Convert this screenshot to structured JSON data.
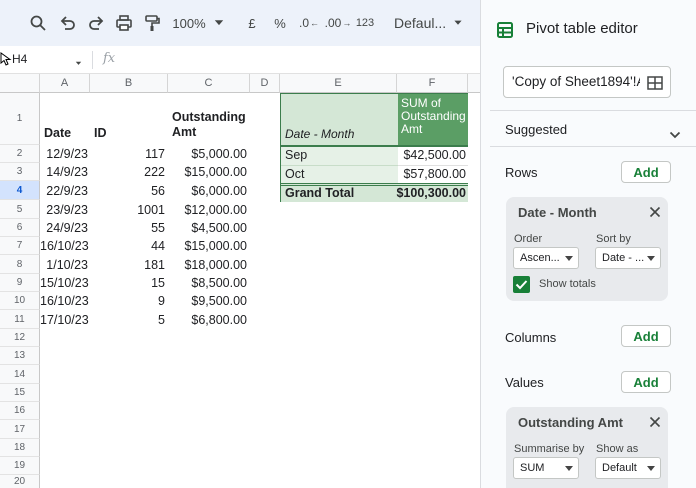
{
  "toolbar": {
    "zoom": "100%",
    "currency": "£",
    "percent": "%",
    "dec_dec": ".0",
    "dec_inc": ".00",
    "num_fmt": "123",
    "font": "Defaul..."
  },
  "formula": {
    "cell_ref": "H4",
    "fx": "fx"
  },
  "columns": [
    "A",
    "B",
    "C",
    "D",
    "E",
    "F"
  ],
  "rows": [
    "1",
    "2",
    "3",
    "4",
    "5",
    "6",
    "7",
    "8",
    "9",
    "10",
    "11",
    "12",
    "13",
    "14",
    "15",
    "16",
    "17",
    "18",
    "19",
    "20"
  ],
  "headers": {
    "date": "Date",
    "id": "ID",
    "amt1": "Outstanding",
    "amt2": "Amt"
  },
  "data": [
    {
      "date": "12/9/23",
      "id": "117",
      "amt": "$5,000.00"
    },
    {
      "date": "14/9/23",
      "id": "222",
      "amt": "$15,000.00"
    },
    {
      "date": "22/9/23",
      "id": "56",
      "amt": "$6,000.00"
    },
    {
      "date": "23/9/23",
      "id": "1001",
      "amt": "$12,000.00"
    },
    {
      "date": "24/9/23",
      "id": "55",
      "amt": "$4,500.00"
    },
    {
      "date": "16/10/23",
      "id": "44",
      "amt": "$15,000.00"
    },
    {
      "date": "1/10/23",
      "id": "181",
      "amt": "$18,000.00"
    },
    {
      "date": "15/10/23",
      "id": "15",
      "amt": "$8,500.00"
    },
    {
      "date": "16/10/23",
      "id": "9",
      "amt": "$9,500.00"
    },
    {
      "date": "17/10/23",
      "id": "5",
      "amt": "$6,800.00"
    }
  ],
  "pivot": {
    "row_header": "Date - Month",
    "val_header_1": "SUM of",
    "val_header_2": "Outstanding",
    "val_header_3": "Amt",
    "rows": [
      {
        "label": "Sep",
        "value": "$42,500.00"
      },
      {
        "label": "Oct",
        "value": "$57,800.00"
      }
    ],
    "total_label": "Grand Total",
    "total_value": "$100,300.00"
  },
  "panel": {
    "title": "Pivot table editor",
    "range": "'Copy of Sheet1894'!A",
    "suggested": "Suggested",
    "rows_label": "Rows",
    "add": "Add",
    "row_card": {
      "title": "Date - Month",
      "order_label": "Order",
      "order_value": "Ascen...",
      "sortby_label": "Sort by",
      "sortby_value": "Date - ...",
      "show_totals": "Show totals"
    },
    "columns_label": "Columns",
    "values_label": "Values",
    "val_card": {
      "title": "Outstanding Amt",
      "summarise_label": "Summarise by",
      "summarise_value": "SUM",
      "showas_label": "Show as",
      "showas_value": "Default"
    }
  },
  "colors": {
    "accent": "#188038",
    "pivot_header": "#5b9e65",
    "pivot_row": "#e6f1e7",
    "pivot_label": "#d4e7d6",
    "selection": "#d3e3fd"
  }
}
